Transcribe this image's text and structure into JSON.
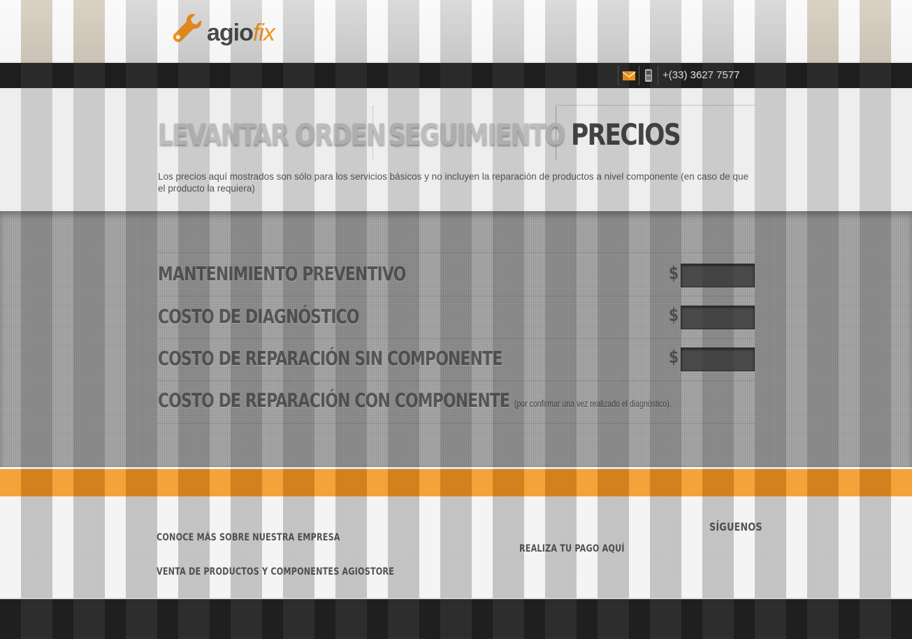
{
  "brand": {
    "logo_main": "agio",
    "logo_accent": "fix",
    "accent_color": "#f0921e"
  },
  "topbar": {
    "mail_icon": "mail-icon",
    "phone_icon": "mobile-phone-icon",
    "phone": "+(33) 3627 7577"
  },
  "tabs": [
    {
      "label": "LEVANTAR ORDEN",
      "active": false
    },
    {
      "label": "SEGUIMIENTO",
      "active": false
    },
    {
      "label": "PRECIOS",
      "active": true
    }
  ],
  "intro": "Los precios aquí mostrados son sólo para los servicios básicos y no incluyen la reparación de productos a nivel componente (en caso de que el producto la requiera)",
  "prices": [
    {
      "label": "MANTENIMIENTO PREVENTIVO",
      "currency": "$",
      "value": ""
    },
    {
      "label": "COSTO DE DIAGNÓSTICO",
      "currency": "$",
      "value": ""
    },
    {
      "label": "COSTO DE REPARACIÓN SIN COMPONENTE",
      "currency": "$",
      "value": ""
    },
    {
      "label": "COSTO DE REPARACIÓN CON COMPONENTE",
      "note": "(por confirmar una vez realizado el diagnóstico)."
    }
  ],
  "footer": {
    "about": "CONOCE MÁS SOBRE NUESTRA EMPRESA",
    "store": "VENTA DE PRODUCTOS Y COMPONENTES AGIOSTORE",
    "payment": "REALIZA TU PAGO AQUÍ",
    "follow": "SÍGUENOS"
  }
}
